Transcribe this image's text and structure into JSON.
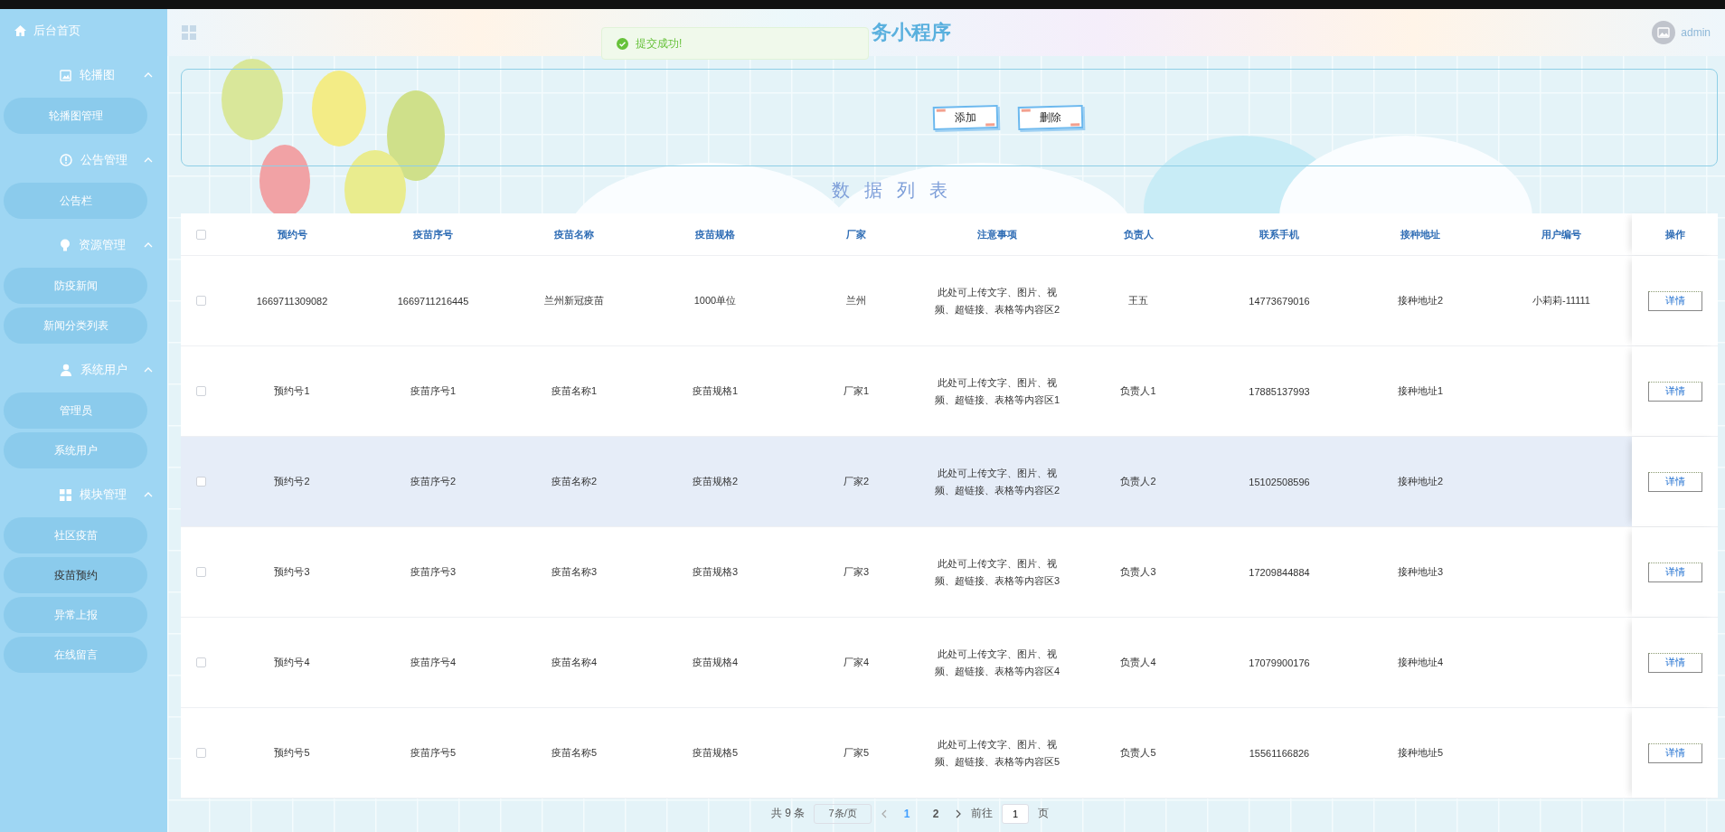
{
  "sidebar": {
    "home": {
      "label": "后台首页"
    },
    "groups": [
      {
        "title": "轮播图",
        "expanded": true,
        "items": [
          {
            "label": "轮播图管理",
            "selected": false
          }
        ]
      },
      {
        "title": "公告管理",
        "expanded": true,
        "items": [
          {
            "label": "公告栏",
            "selected": false
          }
        ]
      },
      {
        "title": "资源管理",
        "expanded": true,
        "items": [
          {
            "label": "防疫新闻",
            "selected": false
          },
          {
            "label": "新闻分类列表",
            "selected": false
          }
        ]
      },
      {
        "title": "系统用户",
        "expanded": true,
        "items": [
          {
            "label": "管理员",
            "selected": false
          },
          {
            "label": "系统用户",
            "selected": false
          }
        ]
      },
      {
        "title": "模块管理",
        "expanded": true,
        "items": [
          {
            "label": "社区疫苗",
            "selected": false
          },
          {
            "label": "疫苗预约",
            "selected": true
          },
          {
            "label": "异常上报",
            "selected": false
          },
          {
            "label": "在线留言",
            "selected": false
          }
        ]
      }
    ]
  },
  "header": {
    "title": "务小程序",
    "user": "admin"
  },
  "toast": {
    "kind": "success",
    "message": "提交成功!"
  },
  "actions": [
    {
      "label": "添加"
    },
    {
      "label": "删除"
    }
  ],
  "section_title": "数据列表",
  "table": {
    "all_checked": false,
    "columns": [
      "预约号",
      "疫苗序号",
      "疫苗名称",
      "疫苗规格",
      "厂家",
      "注意事项",
      "负责人",
      "联系手机",
      "接种地址",
      "用户编号",
      "操作"
    ],
    "rows": [
      {
        "checked": false,
        "hovered": false,
        "cells": [
          "1669711309082",
          "1669711216445",
          "兰州新冠疫苗",
          "1000单位",
          "兰州",
          "此处可上传文字、图片、视频、超链接、表格等内容区2",
          "王五",
          "14773679016",
          "接种地址2",
          "小莉莉-11111"
        ],
        "action": "详情"
      },
      {
        "checked": false,
        "hovered": false,
        "cells": [
          "预约号1",
          "疫苗序号1",
          "疫苗名称1",
          "疫苗规格1",
          "厂家1",
          "此处可上传文字、图片、视频、超链接、表格等内容区1",
          "负责人1",
          "17885137993",
          "接种地址1",
          ""
        ],
        "action": "详情"
      },
      {
        "checked": false,
        "hovered": true,
        "cells": [
          "预约号2",
          "疫苗序号2",
          "疫苗名称2",
          "疫苗规格2",
          "厂家2",
          "此处可上传文字、图片、视频、超链接、表格等内容区2",
          "负责人2",
          "15102508596",
          "接种地址2",
          ""
        ],
        "action": "详情"
      },
      {
        "checked": false,
        "hovered": false,
        "cells": [
          "预约号3",
          "疫苗序号3",
          "疫苗名称3",
          "疫苗规格3",
          "厂家3",
          "此处可上传文字、图片、视频、超链接、表格等内容区3",
          "负责人3",
          "17209844884",
          "接种地址3",
          ""
        ],
        "action": "详情"
      },
      {
        "checked": false,
        "hovered": false,
        "cells": [
          "预约号4",
          "疫苗序号4",
          "疫苗名称4",
          "疫苗规格4",
          "厂家4",
          "此处可上传文字、图片、视频、超链接、表格等内容区4",
          "负责人4",
          "17079900176",
          "接种地址4",
          ""
        ],
        "action": "详情"
      },
      {
        "checked": false,
        "hovered": false,
        "cells": [
          "预约号5",
          "疫苗序号5",
          "疫苗名称5",
          "疫苗规格5",
          "厂家5",
          "此处可上传文字、图片、视频、超链接、表格等内容区5",
          "负责人5",
          "15561166826",
          "接种地址5",
          ""
        ],
        "action": "详情"
      }
    ]
  },
  "pagination": {
    "total": "共 9 条",
    "page_size": "7条/页",
    "pages": [
      {
        "label": "1",
        "selected": true
      },
      {
        "label": "2",
        "selected": false
      }
    ],
    "goto_label": "前往",
    "goto_value": "1",
    "goto_suffix": "页"
  }
}
